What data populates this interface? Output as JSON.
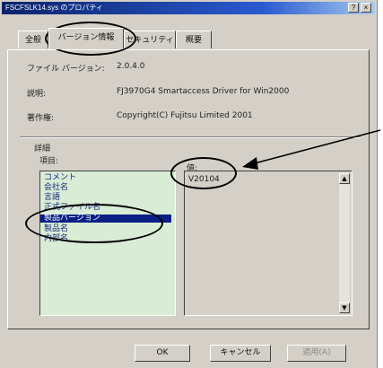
{
  "window": {
    "title": "FSCFSLK14.sys のプロパティ",
    "help_btn": "?",
    "close_btn": "×"
  },
  "tabs": [
    {
      "label": "全般"
    },
    {
      "label": "バージョン情報"
    },
    {
      "label": "セキュリティ"
    },
    {
      "label": "概要"
    }
  ],
  "info": {
    "file_version_label": "ファイル バージョン:",
    "file_version_value": "2.0.4.0",
    "description_label": "説明:",
    "description_value": "FJ3970G4 Smartaccess Driver for Win2000",
    "copyright_label": "著作権:",
    "copyright_value": "Copyright(C) Fujitsu Limited 2001"
  },
  "details": {
    "heading": "詳細",
    "items_label": "項目:",
    "value_label": "値:",
    "items": [
      {
        "label": "コメント"
      },
      {
        "label": "会社名"
      },
      {
        "label": "言語"
      },
      {
        "label": "正式ファイル名"
      },
      {
        "label": "製品バージョン"
      },
      {
        "label": "製品名"
      },
      {
        "label": "内部名"
      }
    ],
    "selected_value": "V20104"
  },
  "buttons": {
    "ok": "OK",
    "cancel": "キャンセル",
    "apply": "適用(A)"
  },
  "colors": {
    "list_bg": "#d8ecd6",
    "selection": "#0a1f86",
    "title_bar": "#0a246a"
  }
}
